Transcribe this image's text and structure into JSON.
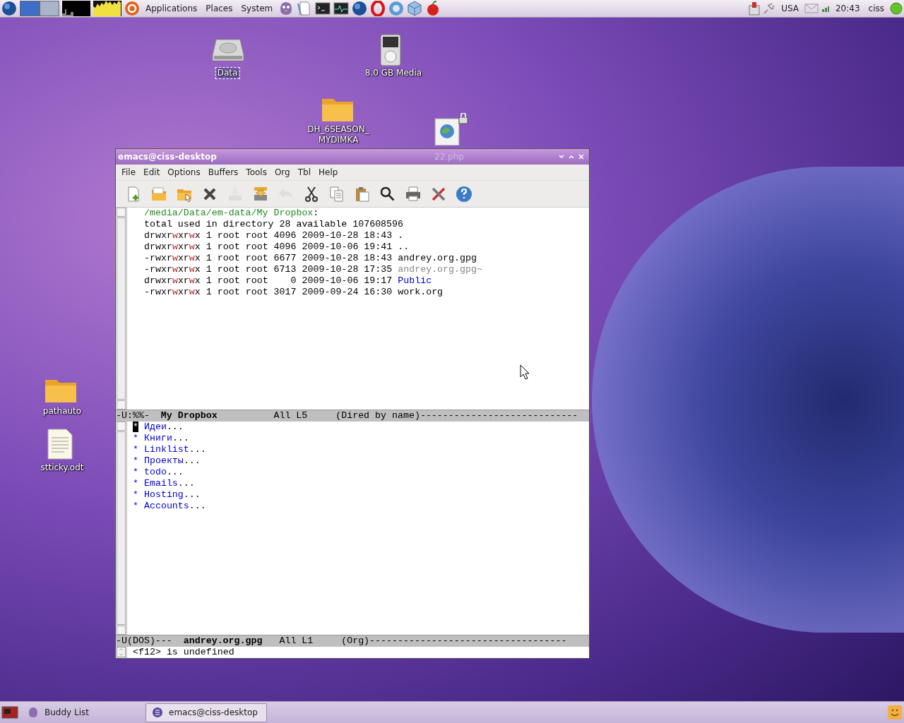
{
  "top_panel": {
    "menus": [
      "Applications",
      "Places",
      "System"
    ],
    "launchers": [
      {
        "kind": "bird"
      },
      {
        "kind": "document"
      },
      {
        "kind": "terminal"
      },
      {
        "kind": "monitor"
      },
      {
        "kind": "globe"
      },
      {
        "kind": "ring"
      },
      {
        "kind": "chrome"
      },
      {
        "kind": "cube"
      },
      {
        "kind": "apple"
      }
    ],
    "workspaces": [
      {
        "selected": true
      },
      {
        "selected": false
      }
    ],
    "keyboard": "USA",
    "clock": "20:43",
    "user": "ciss"
  },
  "desktop_icons": [
    {
      "label": "Data",
      "kind": "drive",
      "selected": true
    },
    {
      "label": "8.0 GB Media",
      "kind": "player",
      "selected": false
    },
    {
      "label": "DH_6SEASON_ MYDIMKA",
      "kind": "folder",
      "selected": false
    },
    {
      "label": "22.php",
      "kind": "php",
      "selected": false
    },
    {
      "label": "pathauto",
      "kind": "folder",
      "selected": false
    },
    {
      "label": "stticky.odt",
      "kind": "doc",
      "selected": false
    }
  ],
  "window": {
    "title": "emacs@ciss-desktop",
    "menu": [
      "File",
      "Edit",
      "Options",
      "Buffers",
      "Tools",
      "Org",
      "Tbl",
      "Help"
    ],
    "toolbar": [
      {
        "kind": "new",
        "disabled": false
      },
      {
        "kind": "open",
        "disabled": false
      },
      {
        "kind": "dir",
        "disabled": false
      },
      {
        "kind": "kill",
        "disabled": false
      },
      {
        "kind": "save",
        "disabled": true
      },
      {
        "kind": "saveas",
        "disabled": false
      },
      {
        "kind": "undo",
        "disabled": true
      },
      {
        "kind": "cut",
        "disabled": false
      },
      {
        "kind": "copy",
        "disabled": false
      },
      {
        "kind": "paste",
        "disabled": false
      },
      {
        "kind": "search",
        "disabled": false
      },
      {
        "kind": "print",
        "disabled": false
      },
      {
        "kind": "prefs",
        "disabled": false
      },
      {
        "kind": "help",
        "disabled": false
      }
    ],
    "dired": {
      "path": "/media/Data/em-data/My Dropbox",
      "suffix": ":",
      "total": "total used in directory 28 available 107608596",
      "rows": [
        {
          "info": "drwxrwxrwx 1 root root 4096 2009-10-28 18:43",
          "name": ".",
          "kind": "dir"
        },
        {
          "info": "drwxrwxrwx 1 root root 4096 2009-10-06 19:41",
          "name": "..",
          "kind": "dir"
        },
        {
          "info": "-rwxrwxrwx 1 root root 6677 2009-10-28 18:43",
          "name": "andrey.org.gpg",
          "kind": "file"
        },
        {
          "info": "-rwxrwxrwx 1 root root 6713 2009-10-28 17:35",
          "name": "andrey.org.gpg~",
          "kind": "backup"
        },
        {
          "info": "drwxrwxrwx 1 root root    0 2009-10-06 19:17",
          "name": "Public",
          "kind": "dir"
        },
        {
          "info": "-rwxrwxrwx 1 root root 3017 2009-09-24 16:30",
          "name": "work.org",
          "kind": "file"
        }
      ]
    },
    "modeline_1": "-U:%%-  **My Dropbox**          All L5     (Dired by name)----------------------------",
    "org": [
      {
        "star": "*",
        "title": "Идеи",
        "fold": "...",
        "cursor": true
      },
      {
        "star": "*",
        "title": "Книги",
        "fold": "...",
        "cursor": false
      },
      {
        "star": "*",
        "title": "Linklist",
        "fold": "...",
        "cursor": false
      },
      {
        "star": "*",
        "title": "Проекты",
        "fold": "...",
        "cursor": false
      },
      {
        "star": "*",
        "title": "todo",
        "fold": "...",
        "cursor": false
      },
      {
        "star": "*",
        "title": "Emails",
        "fold": "...",
        "cursor": false
      },
      {
        "star": "*",
        "title": "Hosting",
        "fold": "...",
        "cursor": false
      },
      {
        "star": "*",
        "title": "Accounts",
        "fold": "...",
        "cursor": false
      }
    ],
    "modeline_2": "-U(DOS)---  **andrey.org.gpg**   All L1     (Org)-----------------------------------",
    "echo": "<f12> is undefined"
  },
  "taskbar": {
    "tasks": [
      {
        "label": "Buddy List",
        "kind": "bird",
        "selected": false
      },
      {
        "label": "emacs@ciss-desktop",
        "kind": "emacs",
        "selected": true
      }
    ]
  }
}
